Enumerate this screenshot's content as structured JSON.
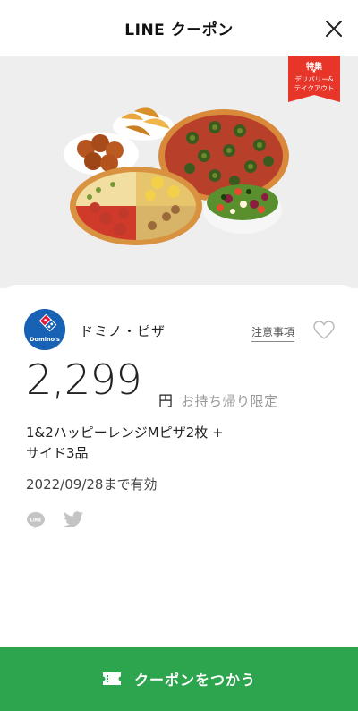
{
  "header": {
    "title": "LINE クーポン"
  },
  "hero": {
    "ribbon": {
      "line1": "特集",
      "star": "★",
      "line2": "デリバリー&",
      "line3": "テイクアウト"
    }
  },
  "brand": {
    "name": "ドミノ・ピザ",
    "logo_text": "Domino's"
  },
  "notes_label": "注意事項",
  "price": {
    "amount": "2,299",
    "currency": "円",
    "condition": "お持ち帰り限定"
  },
  "description": {
    "line1": "1&2ハッピーレンジMピザ2枚 +",
    "line2": "サイド3品"
  },
  "validity": "2022/09/28まで有効",
  "share": {
    "line_label": "LINE"
  },
  "cta": {
    "label": "クーポンをつかう"
  },
  "colors": {
    "cta_green": "#2da44e",
    "ribbon_red": "#e8352a",
    "domino_blue": "#1762b4"
  }
}
